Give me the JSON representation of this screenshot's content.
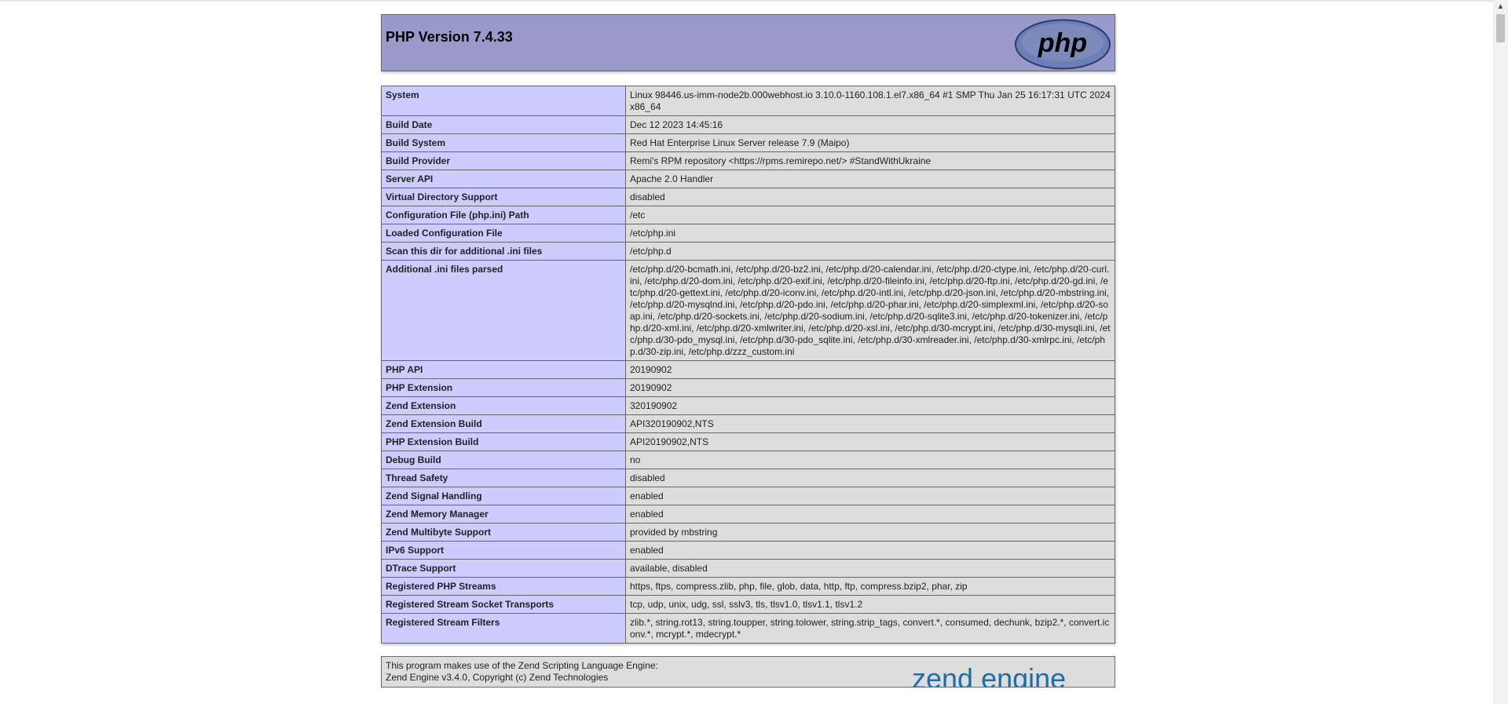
{
  "header": {
    "title": "PHP Version 7.4.33",
    "logo_text": "php"
  },
  "rows": [
    {
      "label": "System",
      "value": "Linux 98446.us-imm-node2b.000webhost.io 3.10.0-1160.108.1.el7.x86_64 #1 SMP Thu Jan 25 16:17:31 UTC 2024 x86_64"
    },
    {
      "label": "Build Date",
      "value": "Dec 12 2023 14:45:16"
    },
    {
      "label": "Build System",
      "value": "Red Hat Enterprise Linux Server release 7.9 (Maipo)"
    },
    {
      "label": "Build Provider",
      "value": "Remi's RPM repository <https://rpms.remirepo.net/> #StandWithUkraine"
    },
    {
      "label": "Server API",
      "value": "Apache 2.0 Handler"
    },
    {
      "label": "Virtual Directory Support",
      "value": "disabled"
    },
    {
      "label": "Configuration File (php.ini) Path",
      "value": "/etc"
    },
    {
      "label": "Loaded Configuration File",
      "value": "/etc/php.ini"
    },
    {
      "label": "Scan this dir for additional .ini files",
      "value": "/etc/php.d"
    },
    {
      "label": "Additional .ini files parsed",
      "value": "/etc/php.d/20-bcmath.ini, /etc/php.d/20-bz2.ini, /etc/php.d/20-calendar.ini, /etc/php.d/20-ctype.ini, /etc/php.d/20-curl.ini, /etc/php.d/20-dom.ini, /etc/php.d/20-exif.ini, /etc/php.d/20-fileinfo.ini, /etc/php.d/20-ftp.ini, /etc/php.d/20-gd.ini, /etc/php.d/20-gettext.ini, /etc/php.d/20-iconv.ini, /etc/php.d/20-intl.ini, /etc/php.d/20-json.ini, /etc/php.d/20-mbstring.ini, /etc/php.d/20-mysqlnd.ini, /etc/php.d/20-pdo.ini, /etc/php.d/20-phar.ini, /etc/php.d/20-simplexml.ini, /etc/php.d/20-soap.ini, /etc/php.d/20-sockets.ini, /etc/php.d/20-sodium.ini, /etc/php.d/20-sqlite3.ini, /etc/php.d/20-tokenizer.ini, /etc/php.d/20-xml.ini, /etc/php.d/20-xmlwriter.ini, /etc/php.d/20-xsl.ini, /etc/php.d/30-mcrypt.ini, /etc/php.d/30-mysqli.ini, /etc/php.d/30-pdo_mysql.ini, /etc/php.d/30-pdo_sqlite.ini, /etc/php.d/30-xmlreader.ini, /etc/php.d/30-xmlrpc.ini, /etc/php.d/30-zip.ini, /etc/php.d/zzz_custom.ini"
    },
    {
      "label": "PHP API",
      "value": "20190902"
    },
    {
      "label": "PHP Extension",
      "value": "20190902"
    },
    {
      "label": "Zend Extension",
      "value": "320190902"
    },
    {
      "label": "Zend Extension Build",
      "value": "API320190902,NTS"
    },
    {
      "label": "PHP Extension Build",
      "value": "API20190902,NTS"
    },
    {
      "label": "Debug Build",
      "value": "no"
    },
    {
      "label": "Thread Safety",
      "value": "disabled"
    },
    {
      "label": "Zend Signal Handling",
      "value": "enabled"
    },
    {
      "label": "Zend Memory Manager",
      "value": "enabled"
    },
    {
      "label": "Zend Multibyte Support",
      "value": "provided by mbstring"
    },
    {
      "label": "IPv6 Support",
      "value": "enabled"
    },
    {
      "label": "DTrace Support",
      "value": "available, disabled"
    },
    {
      "label": "Registered PHP Streams",
      "value": "https, ftps, compress.zlib, php, file, glob, data, http, ftp, compress.bzip2, phar, zip"
    },
    {
      "label": "Registered Stream Socket Transports",
      "value": "tcp, udp, unix, udg, ssl, sslv3, tls, tlsv1.0, tlsv1.1, tlsv1.2"
    },
    {
      "label": "Registered Stream Filters",
      "value": "zlib.*, string.rot13, string.toupper, string.tolower, string.strip_tags, convert.*, consumed, dechunk, bzip2.*, convert.iconv.*, mcrypt.*, mdecrypt.*"
    }
  ],
  "footer": {
    "line1": "This program makes use of the Zend Scripting Language Engine:",
    "line2": "Zend Engine v3.4.0, Copyright (c) Zend Technologies",
    "logo_text": "zend engine"
  },
  "colors": {
    "header_bg": "#9999cc",
    "label_bg": "#ccccff",
    "value_bg": "#dddddd"
  }
}
